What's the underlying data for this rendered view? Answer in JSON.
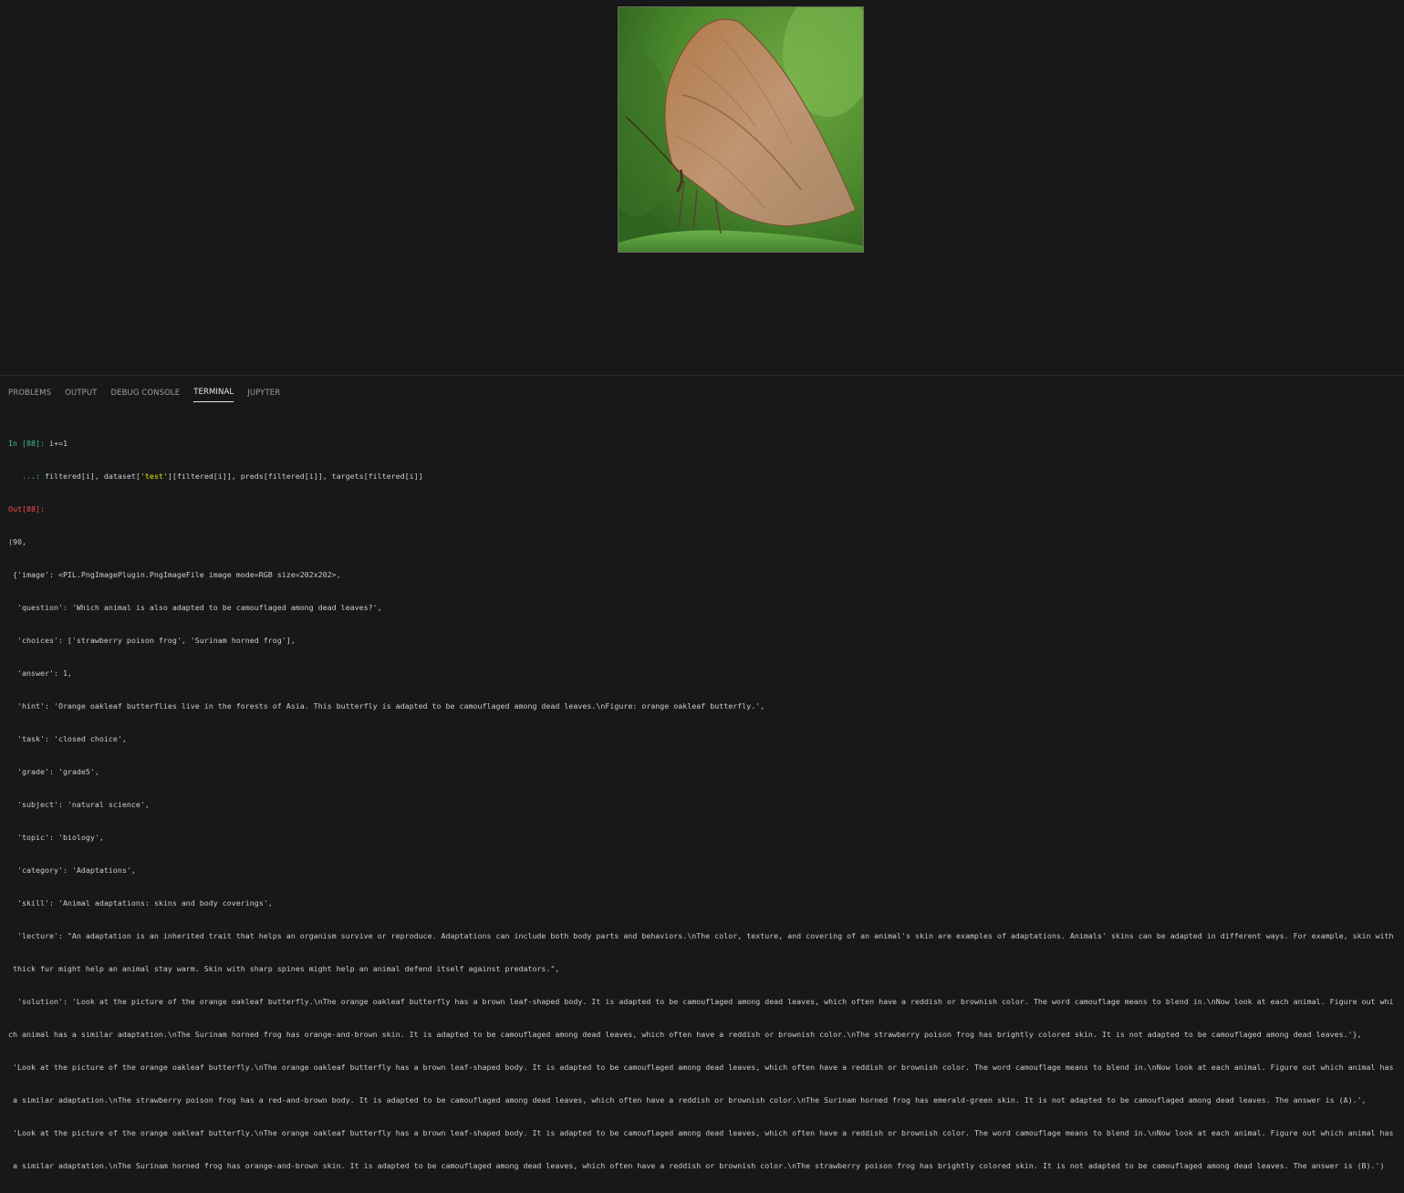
{
  "image_alt_subject": "orange oakleaf butterfly on a leaf",
  "colors": {
    "background": "#181818",
    "prompt_in": "#3dbf8e",
    "prompt_out": "#f14c4c",
    "string_highlight": "#e5e510",
    "text": "#cccccc"
  },
  "panel": {
    "tabs": [
      {
        "label": "PROBLEMS",
        "active": false
      },
      {
        "label": "OUTPUT",
        "active": false
      },
      {
        "label": "DEBUG CONSOLE",
        "active": false
      },
      {
        "label": "TERMINAL",
        "active": true
      },
      {
        "label": "JUPYTER",
        "active": false
      }
    ]
  },
  "terminal": {
    "in_prompt": "In [88]: ",
    "in_code": "i+=1",
    "cont_prompt": "   ...: ",
    "cont_code_a": "filtered[i], dataset[",
    "cont_code_str": "'test'",
    "cont_code_b": "][filtered[i]], preds[filtered[i]], targets[filtered[i]]",
    "out_prompt": "Out[88]:",
    "lines": [
      "(90,",
      " {'image': <PIL.PngImagePlugin.PngImageFile image mode=RGB size=202x202>,",
      "  'question': 'Which animal is also adapted to be camouflaged among dead leaves?',",
      "  'choices': ['strawberry poison frog', 'Surinam horned frog'],",
      "  'answer': 1,",
      "  'hint': 'Orange oakleaf butterflies live in the forests of Asia. This butterfly is adapted to be camouflaged among dead leaves.\\nFigure: orange oakleaf butterfly.',",
      "  'task': 'closed choice',",
      "  'grade': 'grade5',",
      "  'subject': 'natural science',",
      "  'topic': 'biology',",
      "  'category': 'Adaptations',",
      "  'skill': 'Animal adaptations: skins and body coverings',",
      "  'lecture': \"An adaptation is an inherited trait that helps an organism survive or reproduce. Adaptations can include both body parts and behaviors.\\nThe color, texture, and covering of an animal's skin are examples of adaptations. Animals' skins can be adapted in different ways. For example, skin with",
      " thick fur might help an animal stay warm. Skin with sharp spines might help an animal defend itself against predators.\",",
      "  'solution': 'Look at the picture of the orange oakleaf butterfly.\\nThe orange oakleaf butterfly has a brown leaf-shaped body. It is adapted to be camouflaged among dead leaves, which often have a reddish or brownish color. The word camouflage means to blend in.\\nNow look at each animal. Figure out whi",
      "ch animal has a similar adaptation.\\nThe Surinam horned frog has orange-and-brown skin. It is adapted to be camouflaged among dead leaves, which often have a reddish or brownish color.\\nThe strawberry poison frog has brightly colored skin. It is not adapted to be camouflaged among dead leaves.'},",
      " 'Look at the picture of the orange oakleaf butterfly.\\nThe orange oakleaf butterfly has a brown leaf-shaped body. It is adapted to be camouflaged among dead leaves, which often have a reddish or brownish color. The word camouflage means to blend in.\\nNow look at each animal. Figure out which animal has",
      " a similar adaptation.\\nThe strawberry poison frog has a red-and-brown body. It is adapted to be camouflaged among dead leaves, which often have a reddish or brownish color.\\nThe Surinam horned frog has emerald-green skin. It is not adapted to be camouflaged among dead leaves. The answer is (A).',",
      " 'Look at the picture of the orange oakleaf butterfly.\\nThe orange oakleaf butterfly has a brown leaf-shaped body. It is adapted to be camouflaged among dead leaves, which often have a reddish or brownish color. The word camouflage means to blend in.\\nNow look at each animal. Figure out which animal has",
      " a similar adaptation.\\nThe Surinam horned frog has orange-and-brown skin. It is adapted to be camouflaged among dead leaves, which often have a reddish or brownish color.\\nThe strawberry poison frog has brightly colored skin. It is not adapted to be camouflaged among dead leaves. The answer is (B).')"
    ]
  }
}
